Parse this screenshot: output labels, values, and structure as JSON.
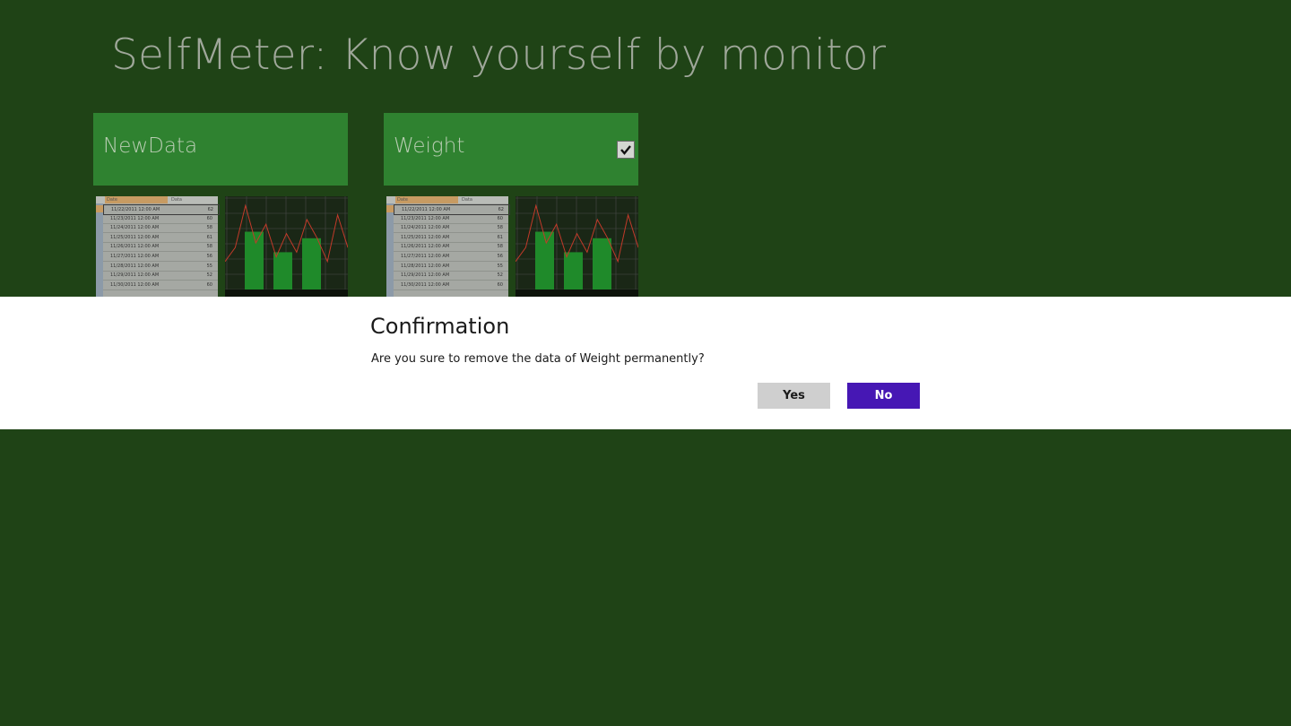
{
  "app": {
    "title": "SelfMeter: Know yourself by monitor"
  },
  "tiles": [
    {
      "label": "NewData",
      "checked": false
    },
    {
      "label": "Weight",
      "checked": true
    }
  ],
  "preview": {
    "table_headers": [
      "Date",
      "Data"
    ],
    "rows": [
      {
        "date": "11/22/2011 12:00 AM",
        "value": "62"
      },
      {
        "date": "11/23/2011 12:00 AM",
        "value": "60"
      },
      {
        "date": "11/24/2011 12:00 AM",
        "value": "58"
      },
      {
        "date": "11/25/2011 12:00 AM",
        "value": "61"
      },
      {
        "date": "11/26/2011 12:00 AM",
        "value": "58"
      },
      {
        "date": "11/27/2011 12:00 AM",
        "value": "56"
      },
      {
        "date": "11/28/2011 12:00 AM",
        "value": "55"
      },
      {
        "date": "11/29/2011 12:00 AM",
        "value": "52"
      },
      {
        "date": "11/30/2011 12:00 AM",
        "value": "60"
      }
    ],
    "bar_values": [
      62,
      40,
      55
    ],
    "line_values": [
      30,
      45,
      90,
      50,
      70,
      35,
      60,
      40,
      75,
      55,
      30,
      80,
      45
    ],
    "colors": {
      "bar": "#1f8a2a",
      "line": "#c23a2a",
      "grid": "#4a4a4a"
    }
  },
  "dialog": {
    "title": "Confirmation",
    "message": "Are you sure to remove the data of Weight permanently?",
    "yes_label": "Yes",
    "no_label": "No",
    "colors": {
      "yes_bg": "#cfcfcf",
      "no_bg": "#4617b4",
      "band_bg": "#ffffff"
    }
  },
  "colors": {
    "background": "#1f4316",
    "tile": "#2f8230"
  }
}
